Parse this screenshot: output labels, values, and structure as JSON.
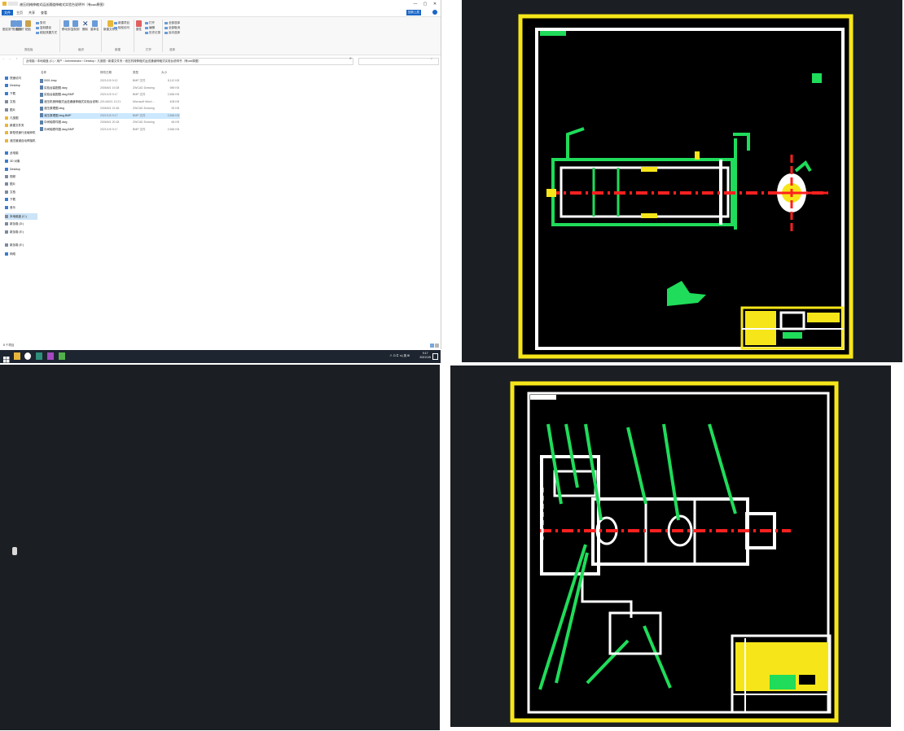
{
  "explorer": {
    "title": "液压机械伸缩式运送通道伸缩式实验台说明书（有cad原图）",
    "window_controls": [
      "—",
      "▢",
      "✕"
    ],
    "tabs": [
      "文件",
      "主页",
      "共享",
      "查看"
    ],
    "ribbon": {
      "pin_label": "固定到\"快速访问\"",
      "copy_label": "复制",
      "paste_label": "粘贴",
      "cut_label": "剪切",
      "copy_path_label": "复制路径",
      "paste_shortcut_label": "粘贴快捷方式",
      "move_to_label": "移动到",
      "copy_to_label": "复制到",
      "delete_label": "删除",
      "rename_label": "重命名",
      "new_folder_label": "新建文件夹",
      "new_item_label": "新建项目",
      "easy_access_label": "轻松访问",
      "properties_label": "属性",
      "open_label": "打开",
      "edit_label": "编辑",
      "history_label": "历史记录",
      "select_all_label": "全部选择",
      "select_none_label": "全部取消",
      "invert_label": "反向选择",
      "groups": [
        "剪贴板",
        "组织",
        "新建",
        "打开",
        "选择"
      ],
      "help_button": "回到上层"
    },
    "address": "此电脑 › 本地磁盘 (C:) › 用户 › Administrator › Desktop › 凡惠图 › 新建文件夹 › 液压机械伸缩式运送通道伸缩式实验台说明书（有cad原图）",
    "nav": [
      {
        "label": "快速访问",
        "color": "#3a7bd5"
      },
      {
        "label": "Desktop",
        "color": "#3a7bd5"
      },
      {
        "label": "下载",
        "color": "#3a7bd5"
      },
      {
        "label": "文档",
        "color": "#7c8aa0"
      },
      {
        "label": "图片",
        "color": "#7c8aa0"
      },
      {
        "label": "凡惠图",
        "color": "#e8b73a"
      },
      {
        "label": "新建文件夹",
        "color": "#e8b73a"
      },
      {
        "label": "新型低速行走破碎机",
        "color": "#e8b73a"
      },
      {
        "label": "液压管道自动焊接机",
        "color": "#e8b73a"
      },
      {
        "label": "此电脑",
        "color": "#3a7bd5"
      },
      {
        "label": "3D 对象",
        "color": "#3a7bd5"
      },
      {
        "label": "Desktop",
        "color": "#3a7bd5"
      },
      {
        "label": "视频",
        "color": "#7c8aa0"
      },
      {
        "label": "图片",
        "color": "#7c8aa0"
      },
      {
        "label": "文档",
        "color": "#7c8aa0"
      },
      {
        "label": "下载",
        "color": "#3a7bd5"
      },
      {
        "label": "音乐",
        "color": "#3a7bd5"
      },
      {
        "label": "本地磁盘 (C:)",
        "color": "#7c8aa0"
      },
      {
        "label": "新加卷 (D:)",
        "color": "#7c8aa0"
      },
      {
        "label": "新加卷 (E:)",
        "color": "#7c8aa0"
      },
      {
        "label": "新加卷 (E:)",
        "color": "#7c8aa0"
      },
      {
        "label": "网络",
        "color": "#3a7bd5"
      }
    ],
    "columns": [
      "名称",
      "修改日期",
      "类型",
      "大小"
    ],
    "files": [
      {
        "name": "0001.bmp",
        "date": "2021/1/5 9:12",
        "type": "BMP 文件",
        "size": "8,112 KB"
      },
      {
        "name": "实验台装配图.dwg",
        "date": "2006/6/1 19:28",
        "type": "ZWCAD Drawing",
        "size": "989 KB"
      },
      {
        "name": "实验台装配图.dwg.BMP",
        "date": "2021/1/5 9:17",
        "type": "BMP 文件",
        "size": "2,566 KB"
      },
      {
        "name": "液压机械伸缩式运送通道伸缩式实验台说明...",
        "date": "2014/6/21 12:21",
        "type": "Microsoft Word ...",
        "size": "408 KB"
      },
      {
        "name": "液压原理图.dwg",
        "date": "2006/6/1 22:48",
        "type": "ZWCAD Drawing",
        "size": "52 KB"
      },
      {
        "name": "液压原理图.dwg.BMP",
        "date": "2021/1/5 9:17",
        "type": "BMP 文件",
        "size": "2,566 KB"
      },
      {
        "name": "中间轴零件图.dwg",
        "date": "2006/6/1 20:18",
        "type": "ZWCAD Drawing",
        "size": "66 KB"
      },
      {
        "name": "中间轴零件图.dwg.BMP",
        "date": "2021/1/5 9:17",
        "type": "BMP 文件",
        "size": "2,566 KB"
      }
    ],
    "status": "8 个项目"
  },
  "taskbar": {
    "time": "9:17",
    "date": "2021/1/5",
    "tray": "∧ ⊡ ⊏ ⊲) 英 ⊞"
  }
}
